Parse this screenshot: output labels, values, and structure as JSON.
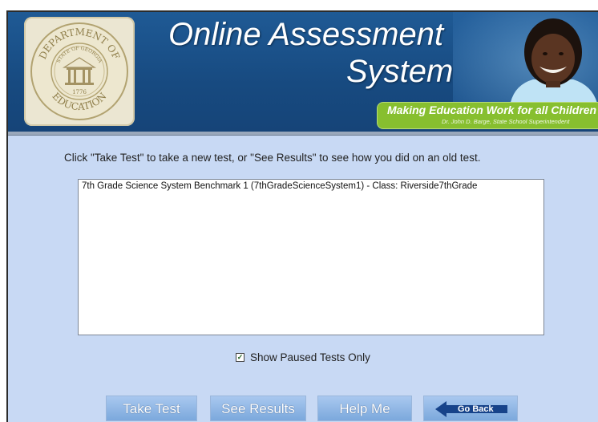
{
  "header": {
    "title_line1": "Online Assessment",
    "title_line2": "System",
    "tagline": "Making Education Work for all Children",
    "superintendent": "Dr. John D. Barge, State School Superintendent",
    "seal": {
      "top_text": "DEPARTMENT OF",
      "bottom_text": "EDUCATION",
      "inner_text": "STATE OF GEORGIA",
      "year": "1776"
    }
  },
  "main": {
    "instruction": "Click \"Take Test\" to take a new test, or \"See Results\" to see how you did on an old test.",
    "tests": [
      "7th Grade Science System Benchmark 1 (7thGradeScienceSystem1) - Class: Riverside7thGrade"
    ],
    "show_paused_label": "Show Paused Tests Only",
    "show_paused_checked": true
  },
  "buttons": {
    "take_test": "Take Test",
    "see_results": "See Results",
    "help_me": "Help Me",
    "go_back": "Go Back"
  },
  "colors": {
    "banner": "#1f5a95",
    "page_bg": "#c8d9f4",
    "tag_band": "#87bf2f",
    "button": "#7ba8dc",
    "back_label_bg": "#17438a"
  }
}
